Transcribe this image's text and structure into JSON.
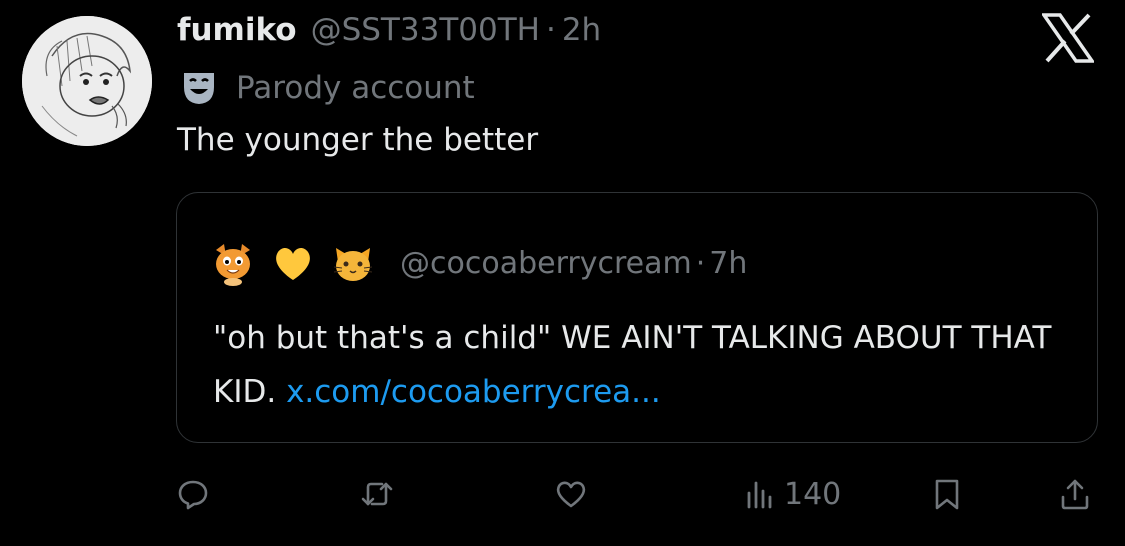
{
  "tweet": {
    "display_name": "fumiko",
    "handle": "@SST33T00TH",
    "separator": "·",
    "time": "2h",
    "badge_label": "Parody account",
    "badge_icon": "theater-mask-icon",
    "text": "The younger the better"
  },
  "quote": {
    "emojis": [
      "cat-face-emoji",
      "yellow-heart-emoji",
      "cat-face-emoji"
    ],
    "handle": "@cocoaberrycream",
    "separator": "·",
    "time": "7h",
    "text": "\"oh but that's a child\" WE AIN'T TALKING ABOUT THAT KID.",
    "link": "x.com/cocoaberrycrea..."
  },
  "actions": {
    "reply_icon": "reply-icon",
    "retweet_icon": "retweet-icon",
    "like_icon": "heart-icon",
    "views_icon": "views-chart-icon",
    "views_count": "140",
    "bookmark_icon": "bookmark-icon",
    "share_icon": "share-icon"
  },
  "colors": {
    "background": "#000000",
    "text": "#e7e9ea",
    "muted": "#71767b",
    "link": "#1d9bf0",
    "border": "#2f3336"
  }
}
